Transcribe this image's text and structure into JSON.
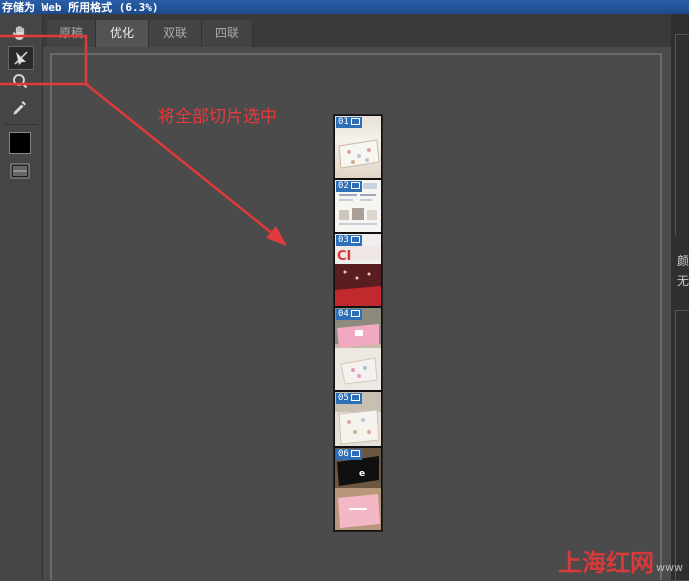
{
  "window": {
    "title": "存储为 Web 所用格式 (6.3%)"
  },
  "tabs": [
    {
      "label": "原稿"
    },
    {
      "label": "优化"
    },
    {
      "label": "双联"
    },
    {
      "label": "四联"
    }
  ],
  "active_tab": "优化",
  "tools": [
    {
      "icon": "hand-icon"
    },
    {
      "icon": "slice-select-icon"
    },
    {
      "icon": "zoom-icon"
    },
    {
      "icon": "eyedropper-icon"
    },
    {
      "icon": "color-swatch-icon",
      "color": "#000000"
    },
    {
      "icon": "toggle-slices-icon"
    }
  ],
  "slices": [
    "01",
    "02",
    "03",
    "04",
    "05",
    "06"
  ],
  "annotation": {
    "text": "将全部切片选中",
    "color": "#e63a3a"
  },
  "right_panel": {
    "label1": "颜",
    "label2": "无"
  },
  "watermark": {
    "text": "上海红网",
    "suffix": "www"
  }
}
